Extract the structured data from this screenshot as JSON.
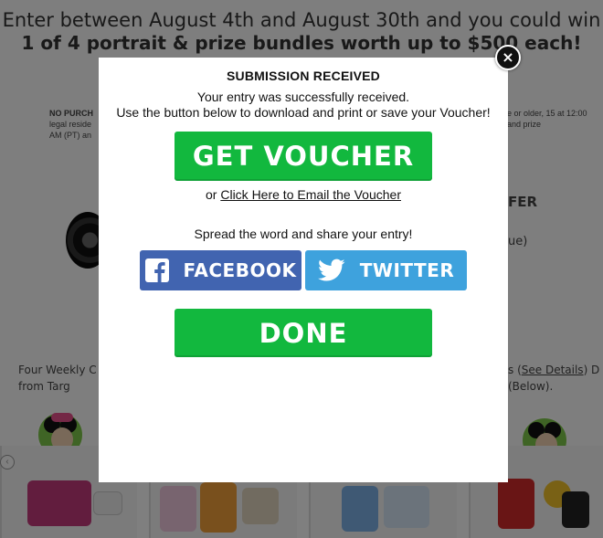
{
  "background": {
    "promo_line1": "Enter between August 4th and August 30th and you could win",
    "promo_line2": "1 of 4 portrait & prize bundles worth up to $500 each!",
    "fine_left_bold": "NO PURCH",
    "fine_left_rest": "legal reside AM (PT) an",
    "fine_right": "e or older, 15 at 12:00 and prize",
    "offer_text": "FER",
    "offer_sub": "ue)",
    "weekly_left": "Four Weekly C from Targ",
    "weekly_right_pre": "s (",
    "weekly_right_link": "See Details",
    "weekly_right_post": ") D (Below)."
  },
  "modal": {
    "title": "SUBMISSION RECEIVED",
    "message_line1": "Your entry was successfully received.",
    "message_line2": "Use the button below to download and print or save your Voucher!",
    "voucher_button": "GET VOUCHER",
    "email_prefix": "or ",
    "email_link": "Click Here to Email the Voucher",
    "share_prompt": "Spread the word and share your entry!",
    "facebook_button": "FACEBOOK",
    "twitter_button": "TWITTER",
    "done_button": "DONE",
    "close_symbol": "×"
  },
  "icons": {
    "close": "close-icon",
    "facebook": "facebook-icon",
    "twitter": "twitter-icon"
  },
  "colors": {
    "green_button": "#12b83e",
    "facebook_blue": "#4164b0",
    "twitter_blue": "#3ea2dd",
    "overlay": "rgba(0,0,0,0.5)"
  }
}
